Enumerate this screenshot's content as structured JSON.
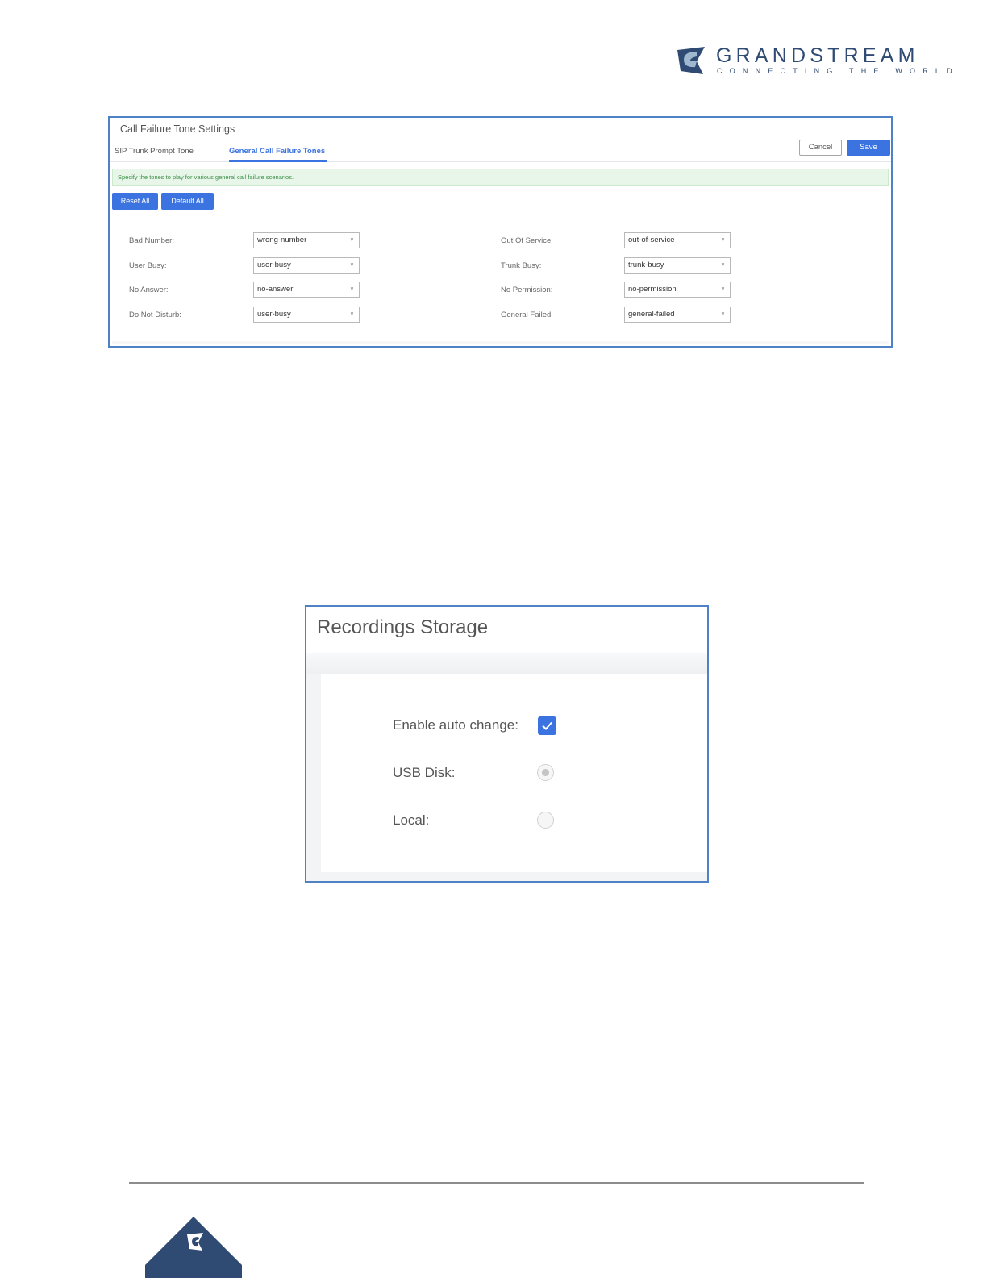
{
  "logo": {
    "brand": "GRANDSTREAM",
    "tagline": "CONNECTING THE WORLD",
    "color": "#2f4b73"
  },
  "call_failure_panel": {
    "title": "Call Failure Tone Settings",
    "tabs": [
      {
        "label": "SIP Trunk Prompt Tone",
        "active": false
      },
      {
        "label": "General Call Failure Tones",
        "active": true
      }
    ],
    "cancel_label": "Cancel",
    "save_label": "Save",
    "notice": "Specify the tones to play for various general call failure scenarios.",
    "reset_all_label": "Reset All",
    "default_all_label": "Default All",
    "fields": [
      {
        "label": "Bad Number:",
        "value": "wrong-number"
      },
      {
        "label": "Out Of Service:",
        "value": "out-of-service"
      },
      {
        "label": "User Busy:",
        "value": "user-busy"
      },
      {
        "label": "Trunk Busy:",
        "value": "trunk-busy"
      },
      {
        "label": "No Answer:",
        "value": "no-answer"
      },
      {
        "label": "No Permission:",
        "value": "no-permission"
      },
      {
        "label": "Do Not Disturb:",
        "value": "user-busy"
      },
      {
        "label": "General Failed:",
        "value": "general-failed"
      }
    ],
    "accent_color": "#3b73e0"
  },
  "recordings_panel": {
    "title": "Recordings Storage",
    "enable_auto_change_label": "Enable auto change:",
    "enable_auto_change_checked": true,
    "usb_disk_label": "USB Disk:",
    "usb_disk_selected": true,
    "local_label": "Local:",
    "local_selected": false
  }
}
